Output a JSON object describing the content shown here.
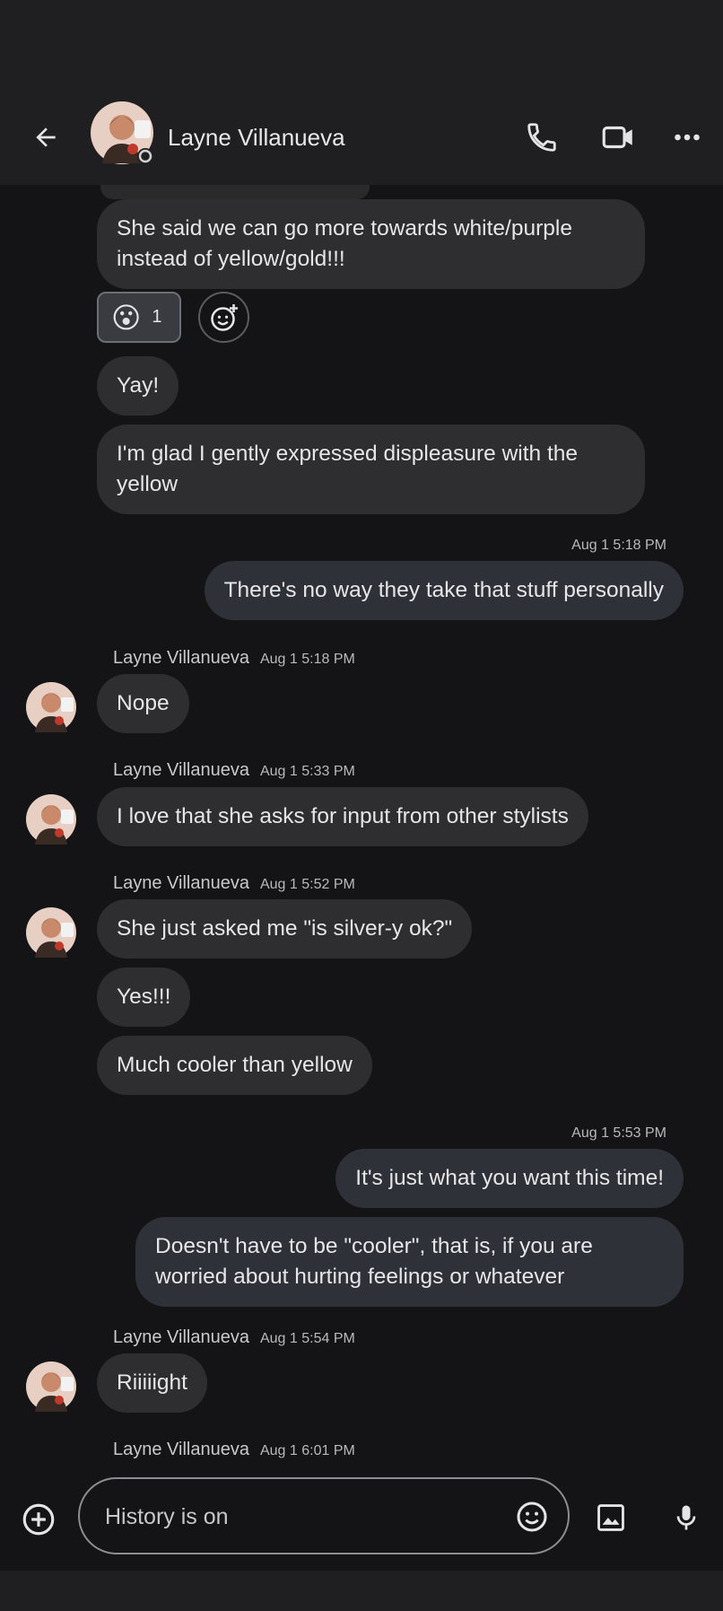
{
  "header": {
    "title": "Layne Villanueva"
  },
  "colors": {
    "background": "#141416",
    "bar": "#1f1f21",
    "incoming_bubble": "#2e2e31",
    "outgoing_bubble": "#2f3138"
  },
  "messages": {
    "m1": "She said we can go more towards white/purple",
    "m1b": "instead of yellow/gold!!!",
    "reaction_emoji": "😮",
    "reaction_count": "1",
    "m2": "Yay!",
    "m3": "I'm glad I gently expressed displeasure with the",
    "m3b": "yellow",
    "ts1": "Aug 1 5:18 PM",
    "m4": "There's no way they take that stuff personally",
    "s1_name": "Layne Villanueva",
    "s1_time": "Aug 1 5:18 PM",
    "m5": "Nope",
    "s2_name": "Layne Villanueva",
    "s2_time": "Aug 1 5:33 PM",
    "m6": "I love that she asks for input from other stylists",
    "s3_name": "Layne Villanueva",
    "s3_time": "Aug 1 5:52 PM",
    "m7": "She just asked me \"is silver-y ok?\"",
    "m8": "Yes!!!",
    "m9": "Much cooler than yellow",
    "ts2": "Aug 1 5:53 PM",
    "m10": "It's just what you want this time!",
    "m11": "Doesn't have to be \"cooler\", that is, if you are",
    "m11b": "worried about hurting feelings or whatever",
    "s4_name": "Layne Villanueva",
    "s4_time": "Aug 1 5:54 PM",
    "m12": "Riiiiight",
    "s5_name": "Layne Villanueva",
    "s5_time": "Aug 1 6:01 PM"
  },
  "composer": {
    "placeholder": "History is on"
  }
}
